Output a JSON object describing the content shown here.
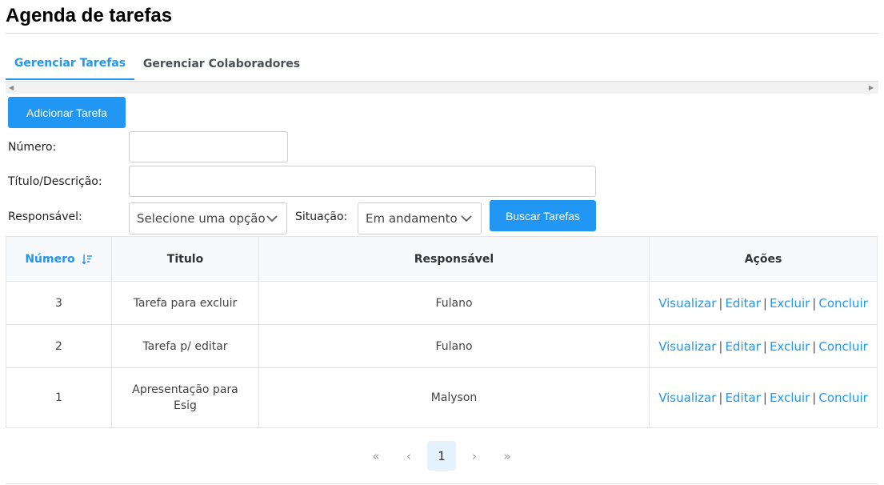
{
  "header": {
    "title": "Agenda de tarefas"
  },
  "tabs": [
    {
      "label": "Gerenciar Tarefas",
      "active": true
    },
    {
      "label": "Gerenciar Colaboradores",
      "active": false
    }
  ],
  "toolbar": {
    "add_label": "Adicionar Tarefa",
    "search_label": "Buscar Tarefas"
  },
  "filters": {
    "number_label": "Número:",
    "number_value": "",
    "title_label": "Título/Descrição:",
    "title_value": "",
    "responsible_label": "Responsável:",
    "responsible_value": "Selecione uma opção",
    "status_label": "Situação:",
    "status_value": "Em andamento"
  },
  "table": {
    "headers": [
      "Número",
      "Titulo",
      "Responsável",
      "Ações"
    ],
    "rows": [
      {
        "number": "3",
        "title": "Tarefa para excluir",
        "responsible": "Fulano"
      },
      {
        "number": "2",
        "title": "Tarefa p/ editar",
        "responsible": "Fulano"
      },
      {
        "number": "1",
        "title": "Apresentação para Esig",
        "responsible": "Malyson"
      }
    ],
    "actions": [
      "Visualizar",
      "Editar",
      "Excluir",
      "Concluir"
    ],
    "action_separator": "|"
  },
  "pagination": {
    "first": "«",
    "prev": "‹",
    "current": "1",
    "next": "›",
    "last": "»"
  },
  "colors": {
    "accent": "#2196f3",
    "header_bg": "#f8f9fa",
    "border": "#e4e4e4"
  },
  "icons": [
    "sort-descending-icon",
    "chevron-down-icon",
    "scroll-left-icon",
    "scroll-right-icon"
  ]
}
